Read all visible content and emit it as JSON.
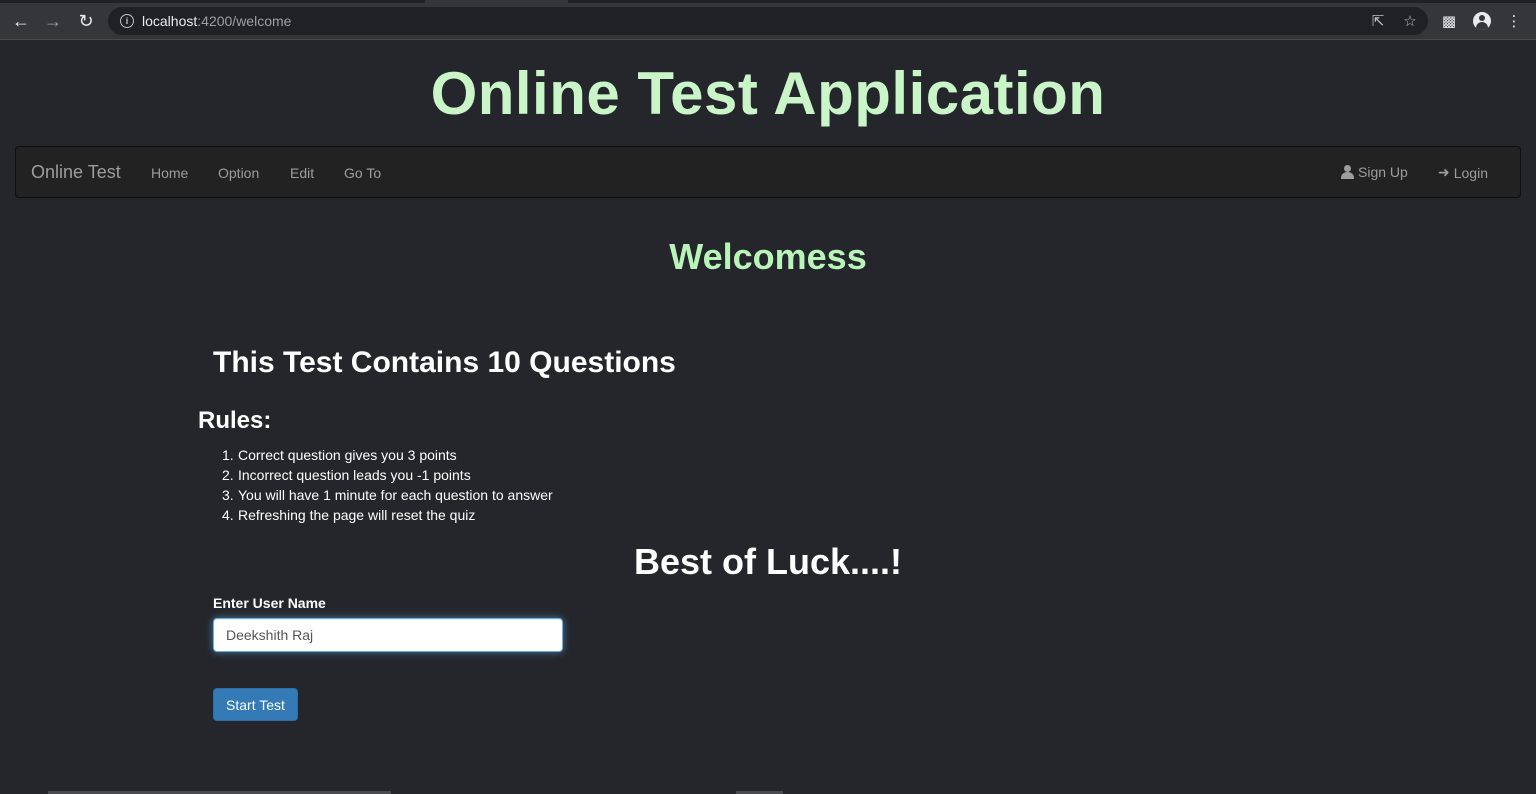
{
  "browser": {
    "url_host": "localhost",
    "url_path": ":4200/welcome"
  },
  "app": {
    "title": "Online Test Application"
  },
  "navbar": {
    "brand": "Online Test",
    "links": [
      "Home",
      "Option",
      "Edit",
      "Go To"
    ],
    "signup": "Sign Up",
    "login": "Login"
  },
  "main": {
    "welcome": "Welcomess",
    "test_heading": "This Test Contains 10 Questions",
    "rules_heading": "Rules:",
    "rules": [
      "Correct question gives you 3 points",
      "Incorrect question leads you -1 points",
      "You will have 1 minute for each question to answer",
      "Refreshing the page will reset the quiz"
    ],
    "luck": "Best of Luck....!",
    "username_label": "Enter User Name",
    "username_value": "Deekshith Raj",
    "start_button": "Start Test"
  },
  "colors": {
    "background": "#24262b",
    "title_green": "#c9f5c9",
    "welcome_green": "#b9f5b9",
    "navbar_bg": "#222222",
    "primary_button": "#337ab7"
  }
}
